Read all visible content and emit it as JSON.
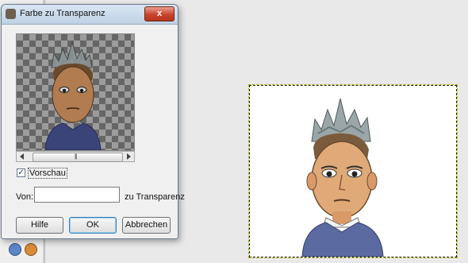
{
  "dialog": {
    "title": "Farbe zu Transparenz",
    "close_glyph": "x",
    "preview_checkbox_label": "Vorschau",
    "preview_checked": true,
    "checkmark_glyph": "✓",
    "scroll_grip_glyph": "|||",
    "from_label": "Von:",
    "to_label": "zu Transparenz",
    "buttons": {
      "help": "Hilfe",
      "ok": "OK",
      "cancel": "Abbrechen"
    }
  },
  "icons": {
    "app": "gimp-wilber-icon",
    "tools": [
      "clone-tool-icon",
      "heal-tool-icon"
    ]
  },
  "colors": {
    "canvas_background": "#ffffff",
    "layer_boundary": "#b6b100",
    "close_button": "#c9432c"
  }
}
